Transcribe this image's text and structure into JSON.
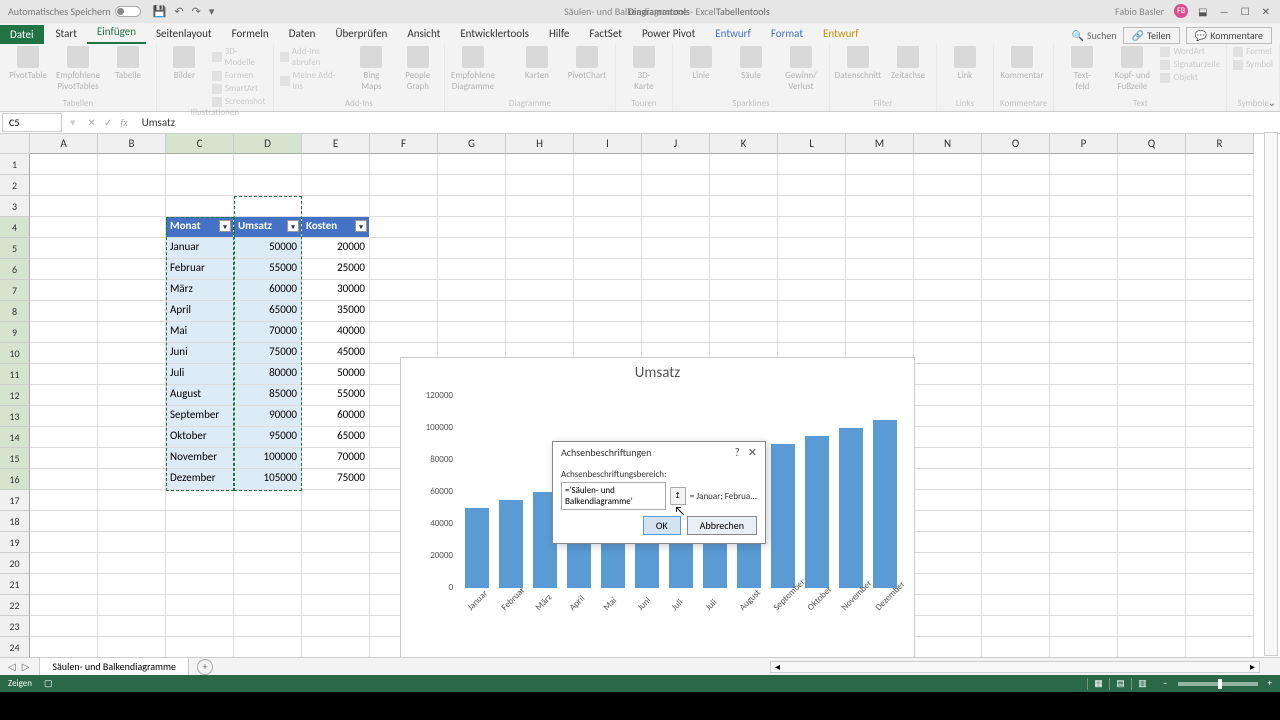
{
  "titlebar": {
    "autosave": "Automatisches Speichern",
    "doc_title": "Säulen- und Balkendiagramme - Excel",
    "tool_tabs": [
      "Diagrammtools",
      "Tabellentools"
    ],
    "user": "Fabio Basler",
    "user_initials": "FB",
    "qat": {
      "save": "💾",
      "undo": "↶",
      "redo": "↷"
    }
  },
  "ribbon_tabs": [
    "Datei",
    "Start",
    "Einfügen",
    "Seitenlayout",
    "Formeln",
    "Daten",
    "Überprüfen",
    "Ansicht",
    "Entwicklertools",
    "Hilfe",
    "FactSet",
    "Power Pivot",
    "Entwurf",
    "Format",
    "Entwurf"
  ],
  "ribbon_active": "Einfügen",
  "ribbon_right": {
    "search_label": "Suchen",
    "share": "Teilen",
    "comments": "Kommentare"
  },
  "ribbon_groups": {
    "g1": {
      "name": "Tabellen",
      "b1": "PivotTable",
      "b2": "Empfohlene\nPivotTables",
      "b3": "Tabelle"
    },
    "g2": {
      "name": "Illustrationen",
      "b1": "Bilder",
      "s1": "Formen",
      "s2": "SmartArt",
      "s3": "Screenshot",
      "s0": "3D-Modelle"
    },
    "g3": {
      "name": "Add-Ins",
      "s1": "Add-Ins abrufen",
      "s2": "Meine Add-Ins",
      "b1": "Bing\nMaps",
      "b2": "People\nGraph"
    },
    "g4": {
      "name": "Diagramme",
      "b1": "Empfohlene\nDiagramme",
      "b2": "Karten",
      "b3": "PivotChart"
    },
    "g5": {
      "name": "Touren",
      "b1": "3D-\nKarte"
    },
    "g6": {
      "name": "Sparklines",
      "b1": "Linie",
      "b2": "Säule",
      "b3": "Gewinn/\nVerlust"
    },
    "g7": {
      "name": "Filter",
      "b1": "Datenschnitt",
      "b2": "Zeitachse"
    },
    "g8": {
      "name": "Links",
      "b1": "Link"
    },
    "g9": {
      "name": "Kommentare",
      "b1": "Kommentar"
    },
    "g10": {
      "name": "Text",
      "b1": "Text-\nfeld",
      "b2": "Kopf- und\nFußzeile",
      "s1": "WordArt",
      "s2": "Signaturzeile",
      "s3": "Objekt"
    },
    "g11": {
      "name": "Symbole",
      "s1": "Formel",
      "s2": "Symbol"
    }
  },
  "formula_bar": {
    "namebox": "C5",
    "formula": "Umsatz"
  },
  "columns": [
    "A",
    "B",
    "C",
    "D",
    "E",
    "F",
    "G",
    "H",
    "I",
    "J",
    "K",
    "L",
    "M",
    "N",
    "O",
    "P",
    "Q",
    "R"
  ],
  "row_count": 25,
  "table": {
    "headers": [
      "Monat",
      "Umsatz",
      "Kosten"
    ],
    "rows": [
      [
        "Januar",
        "50000",
        "20000"
      ],
      [
        "Februar",
        "55000",
        "25000"
      ],
      [
        "März",
        "60000",
        "30000"
      ],
      [
        "April",
        "65000",
        "35000"
      ],
      [
        "Mai",
        "70000",
        "40000"
      ],
      [
        "Juni",
        "75000",
        "45000"
      ],
      [
        "Juli",
        "80000",
        "50000"
      ],
      [
        "August",
        "85000",
        "55000"
      ],
      [
        "September",
        "90000",
        "60000"
      ],
      [
        "Oktober",
        "95000",
        "65000"
      ],
      [
        "November",
        "100000",
        "70000"
      ],
      [
        "Dezember",
        "105000",
        "75000"
      ]
    ]
  },
  "chart_data": {
    "type": "bar",
    "title": "Umsatz",
    "categories": [
      "Januar",
      "Februar",
      "März",
      "April",
      "Mai",
      "Juni",
      "Juli",
      "Juli",
      "August",
      "September",
      "Oktober",
      "November",
      "Dezember"
    ],
    "values": [
      50000,
      55000,
      60000,
      65000,
      70000,
      75000,
      80000,
      80000,
      85000,
      90000,
      95000,
      100000,
      105000
    ],
    "ylim": [
      0,
      120000
    ],
    "yticks": [
      0,
      20000,
      40000,
      60000,
      80000,
      100000,
      120000
    ]
  },
  "dialog": {
    "title": "Achsenbeschriftungen",
    "label": "Achsenbeschriftungsbereich:",
    "input_value": "='Säulen- und Balkendiagramme'",
    "preview": "= Januar; Februa...",
    "ok": "OK",
    "cancel": "Abbrechen"
  },
  "sheet": {
    "name": "Säulen- und Balkendiagramme"
  },
  "statusbar": {
    "mode": "Zeigen",
    "zoom": ""
  }
}
